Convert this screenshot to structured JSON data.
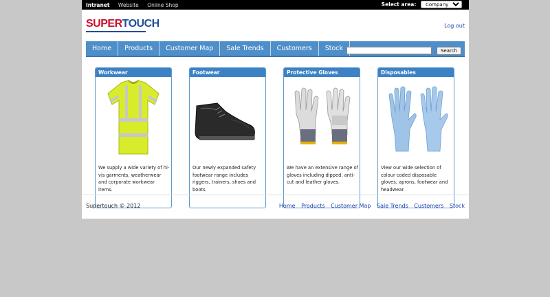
{
  "topbar": {
    "links": [
      "Intranet",
      "Website",
      "Online Shop"
    ],
    "select_area_label": "Select area:",
    "select_area_value": "Company"
  },
  "header": {
    "logo_super": "SUPER",
    "logo_touch": "TOUCH",
    "logout": "Log out"
  },
  "nav": {
    "items": [
      "Home",
      "Products",
      "Customer Map",
      "Sale Trends",
      "Customers",
      "Stock"
    ],
    "search_placeholder": "",
    "search_button": "Search"
  },
  "cards": [
    {
      "title": "Workwear",
      "description": "We supply a wide variety of hi-vis garments, weatherwear and corporate workwear items.",
      "icon": "hi-vis-tshirt-icon"
    },
    {
      "title": "Footwear",
      "description": "Our newly expanded safety footwear range includes riggers, trainers, shoes and boots.",
      "icon": "safety-boot-icon"
    },
    {
      "title": "Protective Gloves",
      "description": "We have an extensive range of gloves including dipped, anti-cut and leather gloves.",
      "icon": "work-gloves-icon"
    },
    {
      "title": "Disposables",
      "description": "View our wide selection of colour coded disposable gloves, aprons, footwear and headwear.",
      "icon": "disposable-gloves-icon"
    }
  ],
  "footer": {
    "copyright": "Supertouch © 2012",
    "links": [
      "Home",
      "Products",
      "Customer Map",
      "Sale Trends",
      "Customers",
      "Stock"
    ]
  },
  "colors": {
    "nav_bg": "#4f8fc9",
    "card_header": "#3c82c4",
    "link": "#1a3fae",
    "logo_red": "#c8102e",
    "logo_blue": "#1f4e9c"
  }
}
